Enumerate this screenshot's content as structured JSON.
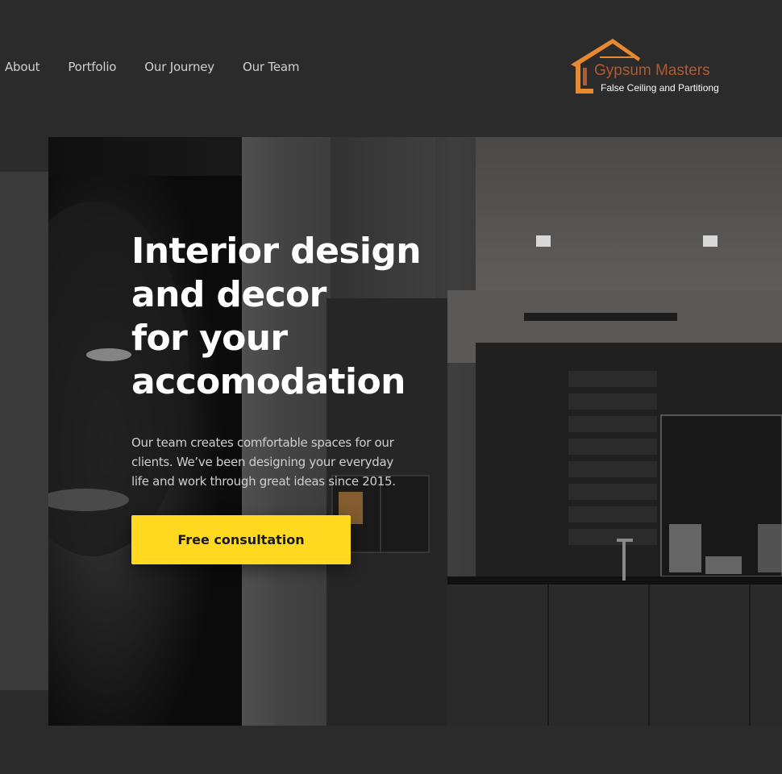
{
  "nav": {
    "links": [
      {
        "label": "About"
      },
      {
        "label": "Portfolio"
      },
      {
        "label": "Our Journey"
      },
      {
        "label": "Our Team"
      }
    ]
  },
  "logo": {
    "title": "Gypsum Masters",
    "subtitle": "False Ceiling and Partitiong",
    "icon": "house-icon",
    "colors": {
      "roof": "#e8892f",
      "title": "#b35a2f"
    }
  },
  "hero": {
    "heading_lines": [
      "Interior design",
      "and decor",
      "for your",
      "accomodation"
    ],
    "description": "Our team creates comfortable spaces for our clients. We’ve been designing your everyday life and work through great ideas since 2015.",
    "cta_label": "Free consultation",
    "image": "dark-kitchen-interior-photo"
  },
  "colors": {
    "background": "#2b2b2b",
    "panel": "#3a3a3a",
    "accent": "#ffd91f",
    "cta_text": "#1a1a1a"
  }
}
